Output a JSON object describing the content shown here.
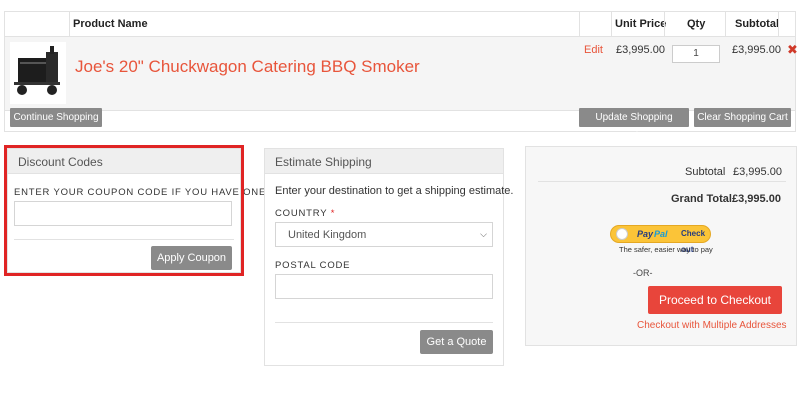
{
  "table": {
    "headers": {
      "product_name": "Product Name",
      "unit_price": "Unit Price",
      "qty": "Qty",
      "subtotal": "Subtotal"
    },
    "item": {
      "name": "Joe's 20\" Chuckwagon Catering BBQ Smoker",
      "edit_label": "Edit",
      "unit_price": "£3,995.00",
      "qty": "1",
      "subtotal": "£3,995.00",
      "remove_icon": "close-icon"
    },
    "buttons": {
      "continue": "Continue Shopping",
      "update": "Update Shopping Basket",
      "clear": "Clear Shopping Cart"
    }
  },
  "discount": {
    "title": "Discount Codes",
    "label": "ENTER YOUR COUPON CODE IF YOU HAVE ONE.",
    "input_value": "",
    "apply_label": "Apply Coupon"
  },
  "shipping": {
    "title": "Estimate Shipping",
    "intro": "Enter your destination to get a shipping estimate.",
    "country_label": "COUNTRY",
    "required_mark": "*",
    "country_value": "United Kingdom",
    "postal_label": "POSTAL CODE",
    "postal_value": "",
    "quote_label": "Get a Quote"
  },
  "totals": {
    "subtotal_label": "Subtotal",
    "subtotal_value": "£3,995.00",
    "grand_total_label": "Grand Total",
    "grand_total_value": "£3,995.00",
    "paypal_pay": "Pay",
    "paypal_pal": "Pal",
    "paypal_checkout": "Check out",
    "paypal_sub": "The safer, easier way to pay",
    "or_label": "-OR-",
    "checkout_label": "Proceed to Checkout",
    "multi_label": "Checkout with Multiple Addresses"
  },
  "colors": {
    "accent": "#e8553b",
    "checkout_button": "#e8453b",
    "highlight_border": "#e02424",
    "grey_button": "#8a8a8a"
  }
}
